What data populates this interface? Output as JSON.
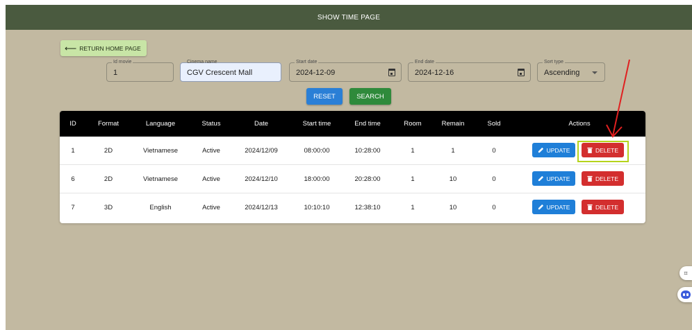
{
  "header": {
    "title": "SHOW TIME PAGE"
  },
  "return_button": {
    "label": "RETURN HOME PAGE"
  },
  "filters": {
    "id_movie": {
      "label": "Id movie",
      "value": "1"
    },
    "cinema_name": {
      "label": "Cinema name",
      "value": "CGV Crescent Mall"
    },
    "start_date": {
      "label": "Start date",
      "value": "2024-12-09"
    },
    "end_date": {
      "label": "End date",
      "value": "2024-12-16"
    },
    "sort_type": {
      "label": "Sort type",
      "value": "Ascending"
    }
  },
  "buttons": {
    "reset": "RESET",
    "search": "SEARCH"
  },
  "table": {
    "headers": [
      "ID",
      "Format",
      "Language",
      "Status",
      "Date",
      "Start time",
      "End time",
      "Room",
      "Remain",
      "Sold",
      "Actions"
    ],
    "rows": [
      [
        "1",
        "2D",
        "Vietnamese",
        "Active",
        "2024/12/09",
        "08:00:00",
        "10:28:00",
        "1",
        "1",
        "0"
      ],
      [
        "6",
        "2D",
        "Vietnamese",
        "Active",
        "2024/12/10",
        "18:00:00",
        "20:28:00",
        "1",
        "10",
        "0"
      ],
      [
        "7",
        "3D",
        "English",
        "Active",
        "2024/12/13",
        "10:10:10",
        "12:38:10",
        "1",
        "10",
        "0"
      ]
    ],
    "update_label": "UPDATE",
    "delete_label": "DELETE"
  },
  "colors": {
    "header_bg": "#4a5a3f",
    "page_bg": "#c2b9a1",
    "update": "#1f7fd8",
    "delete": "#d32e2e",
    "search": "#2f8a3b",
    "reset": "#2a7fd6",
    "annotation_arrow": "#e02020",
    "annotation_box": "#b5d41c"
  }
}
